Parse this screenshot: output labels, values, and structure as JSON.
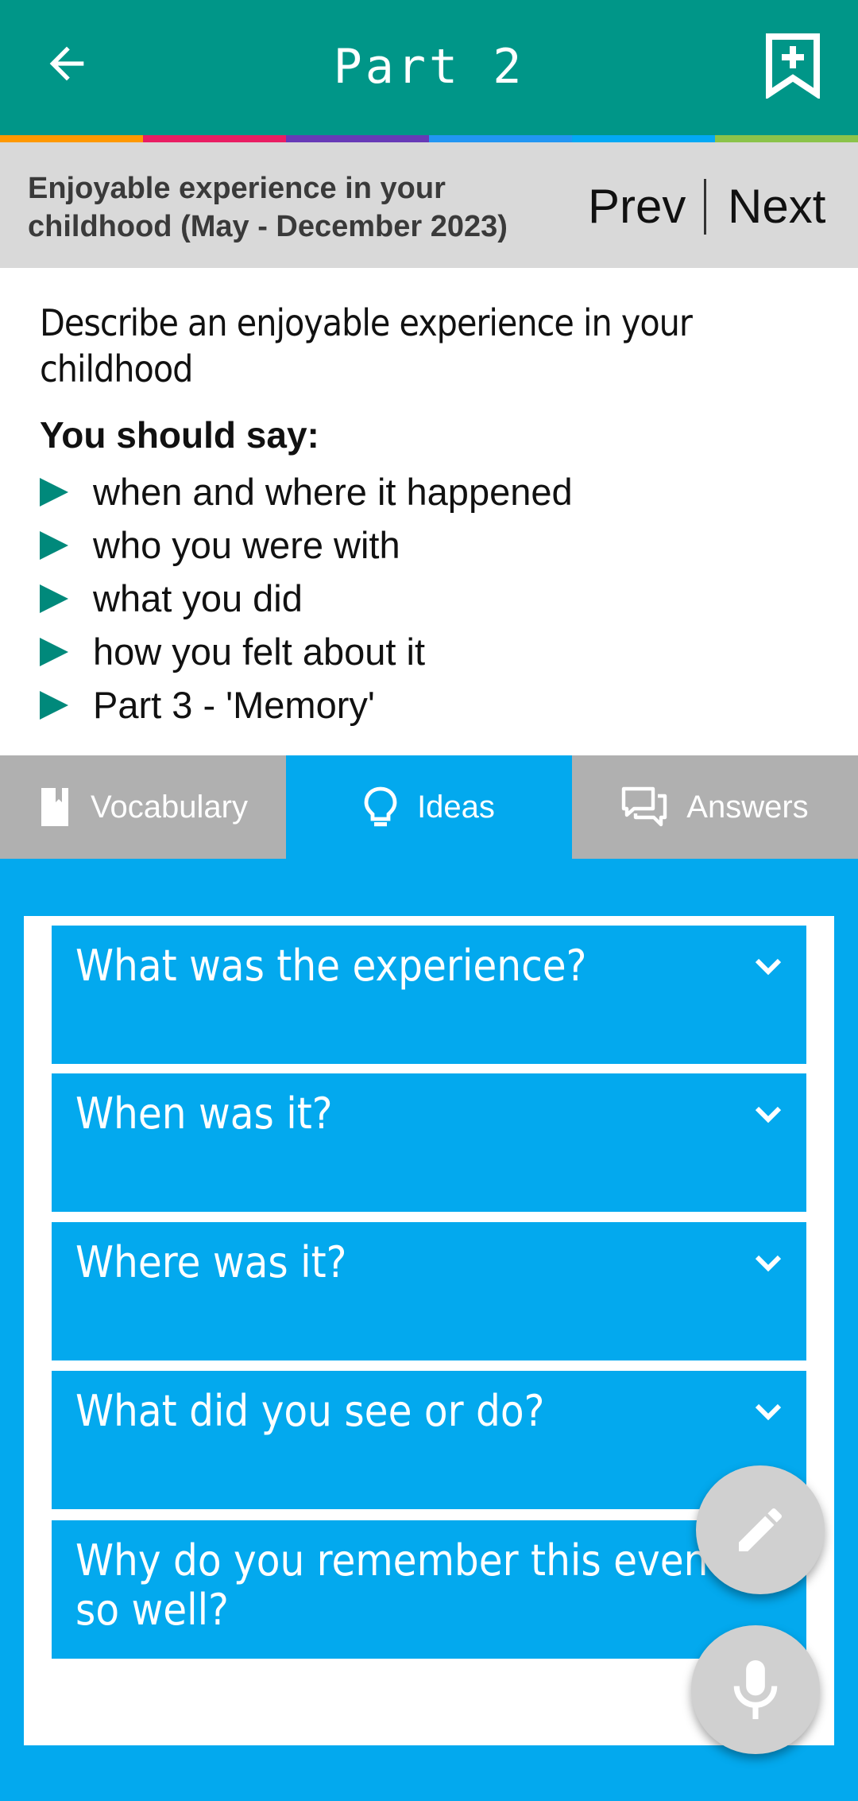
{
  "appbar": {
    "title": "Part 2"
  },
  "topic": {
    "title": "Enjoyable experience in your childhood (May - December 2023)",
    "prev_label": "Prev",
    "next_label": "Next"
  },
  "card": {
    "describe": "Describe an enjoyable experience in your childhood",
    "say_label": "You should say:",
    "bullets": [
      "when and where it happened",
      "who you were with",
      "what you did",
      "how you felt about it",
      "Part 3 - 'Memory'"
    ]
  },
  "tabs": [
    {
      "label": "Vocabulary",
      "icon": "book-icon",
      "active": false
    },
    {
      "label": "Ideas",
      "icon": "lightbulb-icon",
      "active": true
    },
    {
      "label": "Answers",
      "icon": "chat-bubbles-icon",
      "active": false
    }
  ],
  "questions": [
    "What was the experience?",
    "When was it?",
    "Where was it?",
    "What did you see or do?",
    "Why do you remember this event so well?"
  ],
  "colors": {
    "appbar": "#009688",
    "accent_blue": "#03a9ee",
    "stripe": [
      "#ff9800",
      "#e91e63",
      "#673ab7",
      "#2196f3",
      "#03a9f4",
      "#8bc34a"
    ]
  }
}
